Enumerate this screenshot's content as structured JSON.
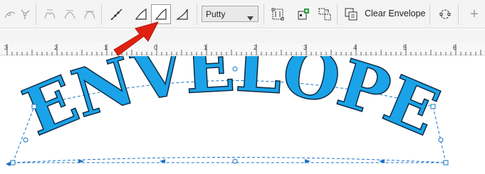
{
  "toolbar": {
    "mode_select_value": "Putty",
    "clear_envelope_label": "Clear Envelope",
    "add_label": "+"
  },
  "ruler": {
    "labels": [
      "3",
      "2",
      "1",
      "0",
      "1",
      "2",
      "3",
      "4",
      "5",
      "6"
    ]
  },
  "canvas": {
    "envelope_text": "ENVELOPE",
    "text_color": "#1aa3e8"
  },
  "colors": {
    "annotation_arrow": "#e02010"
  }
}
